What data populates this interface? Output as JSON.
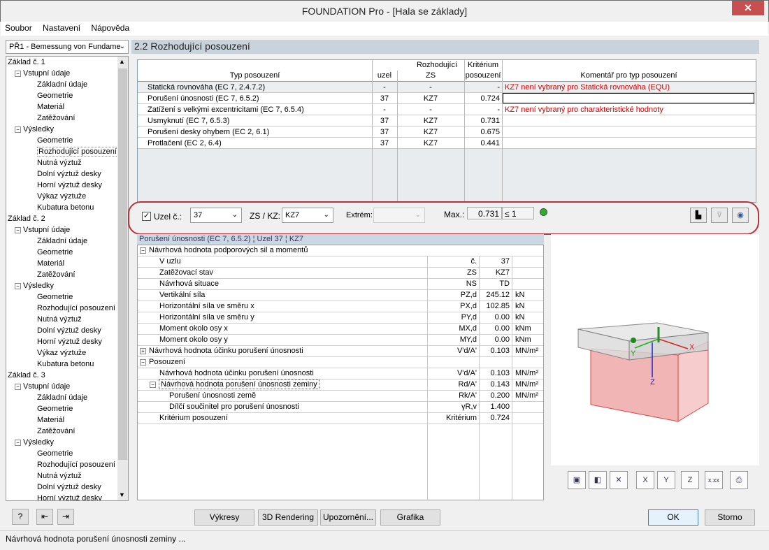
{
  "window": {
    "title": "FOUNDATION Pro - [Hala se základy]",
    "close": "✕"
  },
  "menu": [
    "Soubor",
    "Nastavení",
    "Nápověda"
  ],
  "nav": {
    "combo": "PŘ1 - Bemessung von Fundame",
    "tree": [
      {
        "level": 0,
        "label": "Základ č. 1"
      },
      {
        "level": 1,
        "label": "Vstupní údaje",
        "pm": "-"
      },
      {
        "level": 2,
        "label": "Základní údaje"
      },
      {
        "level": 2,
        "label": "Geometrie"
      },
      {
        "level": 2,
        "label": "Materiál"
      },
      {
        "level": 2,
        "label": "Zatěžování"
      },
      {
        "level": 1,
        "label": "Výsledky",
        "pm": "-"
      },
      {
        "level": 2,
        "label": "Geometrie"
      },
      {
        "level": 2,
        "label": "Rozhodující posouzení",
        "selected": true
      },
      {
        "level": 2,
        "label": "Nutná výztuž"
      },
      {
        "level": 2,
        "label": "Dolní výztuž desky"
      },
      {
        "level": 2,
        "label": "Horní výztuž desky"
      },
      {
        "level": 2,
        "label": "Výkaz výztuže"
      },
      {
        "level": 2,
        "label": "Kubatura betonu"
      },
      {
        "level": 0,
        "label": "Základ č. 2"
      },
      {
        "level": 1,
        "label": "Vstupní údaje",
        "pm": "-"
      },
      {
        "level": 2,
        "label": "Základní údaje"
      },
      {
        "level": 2,
        "label": "Geometrie"
      },
      {
        "level": 2,
        "label": "Materiál"
      },
      {
        "level": 2,
        "label": "Zatěžování"
      },
      {
        "level": 1,
        "label": "Výsledky",
        "pm": "-"
      },
      {
        "level": 2,
        "label": "Geometrie"
      },
      {
        "level": 2,
        "label": "Rozhodující posouzení"
      },
      {
        "level": 2,
        "label": "Nutná výztuž"
      },
      {
        "level": 2,
        "label": "Dolní výztuž desky"
      },
      {
        "level": 2,
        "label": "Horní výztuž desky"
      },
      {
        "level": 2,
        "label": "Výkaz výztuže"
      },
      {
        "level": 2,
        "label": "Kubatura betonu"
      },
      {
        "level": 0,
        "label": "Základ č. 3"
      },
      {
        "level": 1,
        "label": "Vstupní údaje",
        "pm": "-"
      },
      {
        "level": 2,
        "label": "Základní údaje"
      },
      {
        "level": 2,
        "label": "Geometrie"
      },
      {
        "level": 2,
        "label": "Materiál"
      },
      {
        "level": 2,
        "label": "Zatěžování"
      },
      {
        "level": 1,
        "label": "Výsledky",
        "pm": "-"
      },
      {
        "level": 2,
        "label": "Geometrie"
      },
      {
        "level": 2,
        "label": "Rozhodující posouzení"
      },
      {
        "level": 2,
        "label": "Nutná výztuž"
      },
      {
        "level": 2,
        "label": "Dolní výztuž desky"
      },
      {
        "level": 2,
        "label": "Horní výztuž desky"
      }
    ]
  },
  "section_title": "2.2 Rozhodující posouzení",
  "table": {
    "headers": {
      "typ": "Typ posouzení",
      "rozhodujici": "Rozhodující",
      "uzel": "uzel",
      "zs": "ZS",
      "kriterium1": "Kritérium",
      "kriterium2": "posouzení",
      "komentar": "Komentář pro typ posouzení"
    },
    "rows": [
      {
        "typ": "Statická rovnováha (EC 7, 2.4.7.2)",
        "uzel": "-",
        "zs": "-",
        "krit": "-",
        "kom": "KZ7 není vybraný pro Statická rovnováha (EQU)",
        "red": true
      },
      {
        "typ": "Porušení únosnosti (EC 7, 6.5.2)",
        "uzel": "37",
        "zs": "KZ7",
        "krit": "0.724",
        "kom": "",
        "edit": true
      },
      {
        "typ": "Zatížení s velkými excentricitami (EC 7, 6.5.4)",
        "uzel": "-",
        "zs": "-",
        "krit": "-",
        "kom": "KZ7 není vybraný pro charakteristické hodnoty",
        "red": true
      },
      {
        "typ": "Usmyknutí (EC 7, 6.5.3)",
        "uzel": "37",
        "zs": "KZ7",
        "krit": "0.731",
        "kom": ""
      },
      {
        "typ": "Porušení desky ohybem (EC 2, 6.1)",
        "uzel": "37",
        "zs": "KZ7",
        "krit": "0.675",
        "kom": ""
      },
      {
        "typ": "Protlačení (EC 2, 6.4)",
        "uzel": "37",
        "zs": "KZ7",
        "krit": "0.441",
        "kom": ""
      }
    ]
  },
  "controls": {
    "uzel_label": "Uzel č.:",
    "uzel_value": "37",
    "zskz_label": "ZS / KZ:",
    "zskz_value": "KZ7",
    "extrem_label": "Extrém:",
    "extrem_value": "",
    "max_label": "Max.:",
    "max_value": "0.731",
    "max_limit": "≤ 1"
  },
  "details": {
    "title": "Porušení únosnosti (EC 7, 6.5.2) ¦ Uzel  37 ¦ KZ7",
    "rows": [
      {
        "indent": 0,
        "pm": "-",
        "label": "Návrhová hodnota podporových sil a momentů",
        "sym": "",
        "val": "",
        "unit": "",
        "group": true
      },
      {
        "indent": 1,
        "label": "V uzlu",
        "sym": "č.",
        "val": "37",
        "unit": ""
      },
      {
        "indent": 1,
        "label": "Zatěžovací stav",
        "sym": "ZS",
        "val": "KZ7",
        "unit": ""
      },
      {
        "indent": 1,
        "label": "Návrhová situace",
        "sym": "NS",
        "val": "TD",
        "unit": ""
      },
      {
        "indent": 1,
        "label": "Vertikální síla",
        "sym": "PZ,d",
        "val": "245.12",
        "unit": "kN"
      },
      {
        "indent": 1,
        "label": "Horizontální síla ve směru x",
        "sym": "PX,d",
        "val": "102.85",
        "unit": "kN"
      },
      {
        "indent": 1,
        "label": "Horizontální síla ve směru y",
        "sym": "PY,d",
        "val": "0.00",
        "unit": "kN"
      },
      {
        "indent": 1,
        "label": "Moment okolo osy x",
        "sym": "MX,d",
        "val": "0.00",
        "unit": "kNm"
      },
      {
        "indent": 1,
        "label": "Moment okolo osy y",
        "sym": "MY,d",
        "val": "0.00",
        "unit": "kNm"
      },
      {
        "indent": 0,
        "pm": "+",
        "label": "Návrhová hodnota účinku porušení únosnosti",
        "sym": "V'd/A'",
        "val": "0.103",
        "unit": "MN/m²"
      },
      {
        "indent": 0,
        "pm": "-",
        "label": "Posouzení",
        "sym": "",
        "val": "",
        "unit": "",
        "group": true
      },
      {
        "indent": 1,
        "label": "Návrhová hodnota účinku porušení únosnosti",
        "sym": "V'd/A'",
        "val": "0.103",
        "unit": "MN/m²"
      },
      {
        "indent": 1,
        "pm": "-",
        "label": "Návrhová hodnota porušení únosnosti zeminy",
        "sym": "Rd/A'",
        "val": "0.143",
        "unit": "MN/m²",
        "focus": true
      },
      {
        "indent": 2,
        "label": "Porušení únosnosti země",
        "sym": "Rk/A'",
        "val": "0.200",
        "unit": "MN/m²"
      },
      {
        "indent": 2,
        "label": "Dílčí součinitel pro porušení únosnosti",
        "sym": "γR,v",
        "val": "1.400",
        "unit": ""
      },
      {
        "indent": 1,
        "label": "Kritérium posouzení",
        "sym": "Kritérium",
        "val": "0.724",
        "unit": ""
      }
    ]
  },
  "view3d": {
    "axis_x": "X",
    "axis_y": "Y",
    "axis_z": "Z",
    "btn_labels": [
      "▣",
      "◧",
      "✕",
      "X",
      "Y",
      "Z",
      "x.xx",
      "⎙"
    ]
  },
  "buttons": {
    "help": "?",
    "vykresy": "Výkresy",
    "rendering": "3D Rendering",
    "upozorneni": "Upozornění...",
    "grafika": "Grafika",
    "ok": "OK",
    "storno": "Storno"
  },
  "status": "Návrhová hodnota porušení únosnosti zeminy ...",
  "colors": {
    "accent_red": "#b6333b",
    "ok_green": "#3aa53a",
    "header_bg": "#c9d3dc"
  }
}
